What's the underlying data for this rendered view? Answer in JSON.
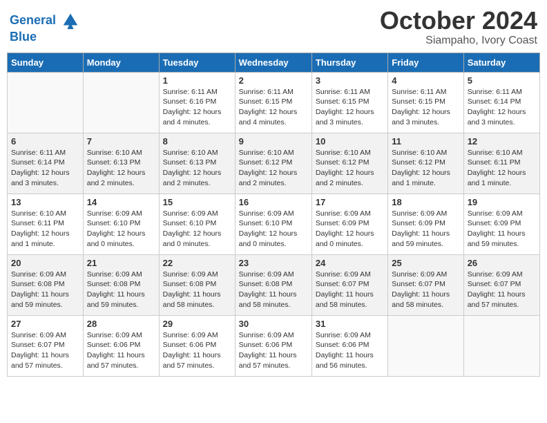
{
  "logo": {
    "line1": "General",
    "line2": "Blue"
  },
  "title": "October 2024",
  "subtitle": "Siampaho, Ivory Coast",
  "days_header": [
    "Sunday",
    "Monday",
    "Tuesday",
    "Wednesday",
    "Thursday",
    "Friday",
    "Saturday"
  ],
  "weeks": [
    [
      {
        "num": "",
        "info": ""
      },
      {
        "num": "",
        "info": ""
      },
      {
        "num": "1",
        "info": "Sunrise: 6:11 AM\nSunset: 6:16 PM\nDaylight: 12 hours and 4 minutes."
      },
      {
        "num": "2",
        "info": "Sunrise: 6:11 AM\nSunset: 6:15 PM\nDaylight: 12 hours and 4 minutes."
      },
      {
        "num": "3",
        "info": "Sunrise: 6:11 AM\nSunset: 6:15 PM\nDaylight: 12 hours and 3 minutes."
      },
      {
        "num": "4",
        "info": "Sunrise: 6:11 AM\nSunset: 6:15 PM\nDaylight: 12 hours and 3 minutes."
      },
      {
        "num": "5",
        "info": "Sunrise: 6:11 AM\nSunset: 6:14 PM\nDaylight: 12 hours and 3 minutes."
      }
    ],
    [
      {
        "num": "6",
        "info": "Sunrise: 6:11 AM\nSunset: 6:14 PM\nDaylight: 12 hours and 3 minutes."
      },
      {
        "num": "7",
        "info": "Sunrise: 6:10 AM\nSunset: 6:13 PM\nDaylight: 12 hours and 2 minutes."
      },
      {
        "num": "8",
        "info": "Sunrise: 6:10 AM\nSunset: 6:13 PM\nDaylight: 12 hours and 2 minutes."
      },
      {
        "num": "9",
        "info": "Sunrise: 6:10 AM\nSunset: 6:12 PM\nDaylight: 12 hours and 2 minutes."
      },
      {
        "num": "10",
        "info": "Sunrise: 6:10 AM\nSunset: 6:12 PM\nDaylight: 12 hours and 2 minutes."
      },
      {
        "num": "11",
        "info": "Sunrise: 6:10 AM\nSunset: 6:12 PM\nDaylight: 12 hours and 1 minute."
      },
      {
        "num": "12",
        "info": "Sunrise: 6:10 AM\nSunset: 6:11 PM\nDaylight: 12 hours and 1 minute."
      }
    ],
    [
      {
        "num": "13",
        "info": "Sunrise: 6:10 AM\nSunset: 6:11 PM\nDaylight: 12 hours and 1 minute."
      },
      {
        "num": "14",
        "info": "Sunrise: 6:09 AM\nSunset: 6:10 PM\nDaylight: 12 hours and 0 minutes."
      },
      {
        "num": "15",
        "info": "Sunrise: 6:09 AM\nSunset: 6:10 PM\nDaylight: 12 hours and 0 minutes."
      },
      {
        "num": "16",
        "info": "Sunrise: 6:09 AM\nSunset: 6:10 PM\nDaylight: 12 hours and 0 minutes."
      },
      {
        "num": "17",
        "info": "Sunrise: 6:09 AM\nSunset: 6:09 PM\nDaylight: 12 hours and 0 minutes."
      },
      {
        "num": "18",
        "info": "Sunrise: 6:09 AM\nSunset: 6:09 PM\nDaylight: 11 hours and 59 minutes."
      },
      {
        "num": "19",
        "info": "Sunrise: 6:09 AM\nSunset: 6:09 PM\nDaylight: 11 hours and 59 minutes."
      }
    ],
    [
      {
        "num": "20",
        "info": "Sunrise: 6:09 AM\nSunset: 6:08 PM\nDaylight: 11 hours and 59 minutes."
      },
      {
        "num": "21",
        "info": "Sunrise: 6:09 AM\nSunset: 6:08 PM\nDaylight: 11 hours and 59 minutes."
      },
      {
        "num": "22",
        "info": "Sunrise: 6:09 AM\nSunset: 6:08 PM\nDaylight: 11 hours and 58 minutes."
      },
      {
        "num": "23",
        "info": "Sunrise: 6:09 AM\nSunset: 6:08 PM\nDaylight: 11 hours and 58 minutes."
      },
      {
        "num": "24",
        "info": "Sunrise: 6:09 AM\nSunset: 6:07 PM\nDaylight: 11 hours and 58 minutes."
      },
      {
        "num": "25",
        "info": "Sunrise: 6:09 AM\nSunset: 6:07 PM\nDaylight: 11 hours and 58 minutes."
      },
      {
        "num": "26",
        "info": "Sunrise: 6:09 AM\nSunset: 6:07 PM\nDaylight: 11 hours and 57 minutes."
      }
    ],
    [
      {
        "num": "27",
        "info": "Sunrise: 6:09 AM\nSunset: 6:07 PM\nDaylight: 11 hours and 57 minutes."
      },
      {
        "num": "28",
        "info": "Sunrise: 6:09 AM\nSunset: 6:06 PM\nDaylight: 11 hours and 57 minutes."
      },
      {
        "num": "29",
        "info": "Sunrise: 6:09 AM\nSunset: 6:06 PM\nDaylight: 11 hours and 57 minutes."
      },
      {
        "num": "30",
        "info": "Sunrise: 6:09 AM\nSunset: 6:06 PM\nDaylight: 11 hours and 57 minutes."
      },
      {
        "num": "31",
        "info": "Sunrise: 6:09 AM\nSunset: 6:06 PM\nDaylight: 11 hours and 56 minutes."
      },
      {
        "num": "",
        "info": ""
      },
      {
        "num": "",
        "info": ""
      }
    ]
  ]
}
